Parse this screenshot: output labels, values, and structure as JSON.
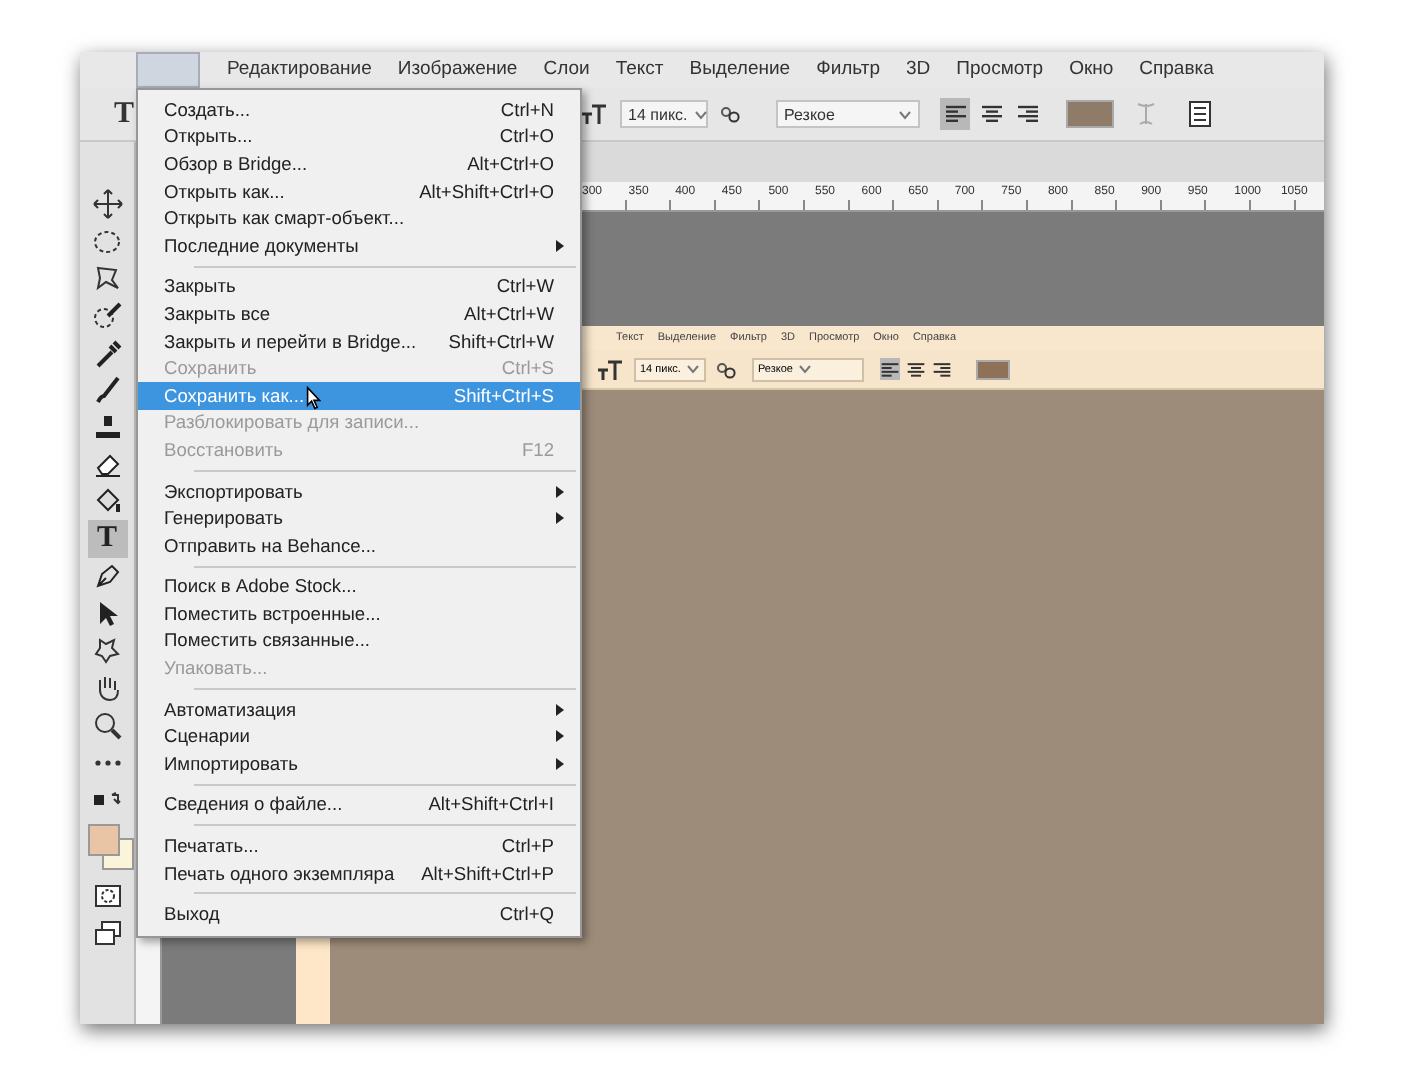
{
  "menubar": {
    "items": [
      {
        "selected": true
      },
      {
        "label": "Редактирование",
        "selected": false
      },
      {
        "label": "Изображение",
        "selected": false
      },
      {
        "label": "Слои",
        "selected": false
      },
      {
        "label": "Текст",
        "selected": false
      },
      {
        "label": "Выделение",
        "selected": false
      },
      {
        "label": "Фильтр",
        "selected": false
      },
      {
        "label": "3D",
        "selected": false
      },
      {
        "label": "Просмотр",
        "selected": false
      },
      {
        "label": "Окно",
        "selected": false
      },
      {
        "label": "Справка",
        "selected": false
      }
    ]
  },
  "options_bar": {
    "tool_glyph": "T",
    "font_size": "14 пикс.",
    "antialias": "Резкое",
    "align": [
      {
        "selected": true
      },
      {
        "selected": false
      },
      {
        "selected": false
      }
    ]
  },
  "tools": [
    {
      "kind": "move",
      "selected": false
    },
    {
      "kind": "marquee",
      "selected": false
    },
    {
      "kind": "lasso",
      "selected": false
    },
    {
      "kind": "quick-select",
      "selected": false
    },
    {
      "kind": "eyedropper",
      "selected": false
    },
    {
      "kind": "brush",
      "selected": false
    },
    {
      "kind": "stamp",
      "selected": false
    },
    {
      "kind": "eraser",
      "selected": false
    },
    {
      "kind": "bucket",
      "selected": false
    },
    {
      "kind": "glyph",
      "glyph": "T",
      "selected": true
    },
    {
      "kind": "pen",
      "selected": false
    },
    {
      "kind": "arrow",
      "selected": false
    },
    {
      "kind": "shape",
      "selected": false
    },
    {
      "kind": "hand",
      "selected": false
    },
    {
      "kind": "zoom",
      "selected": false
    },
    {
      "kind": "more",
      "selected": false
    },
    {
      "kind": "swap",
      "selected": false
    },
    {
      "kind": "colors",
      "selected": false
    },
    {
      "kind": "quickmask",
      "selected": false
    },
    {
      "kind": "screen",
      "selected": false
    }
  ],
  "ruler": [
    "300",
    "350",
    "400",
    "450",
    "500",
    "550",
    "600",
    "650",
    "700",
    "750",
    "800",
    "850",
    "900",
    "950",
    "1000",
    "1050"
  ],
  "file_menu": [
    [
      {
        "label": "Создать...",
        "shortcut": "Ctrl+N",
        "submenu": false,
        "disabled": false,
        "selected": false
      },
      {
        "label": "Открыть...",
        "shortcut": "Ctrl+O",
        "submenu": false,
        "disabled": false,
        "selected": false
      },
      {
        "label": "Обзор в Bridge...",
        "shortcut": "Alt+Ctrl+O",
        "submenu": false,
        "disabled": false,
        "selected": false
      },
      {
        "label": "Открыть как...",
        "shortcut": "Alt+Shift+Ctrl+O",
        "submenu": false,
        "disabled": false,
        "selected": false
      },
      {
        "label": "Открыть как смарт-объект...",
        "submenu": false,
        "disabled": false,
        "selected": false
      },
      {
        "label": "Последние документы",
        "submenu": true,
        "disabled": false,
        "selected": false
      }
    ],
    [
      {
        "label": "Закрыть",
        "shortcut": "Ctrl+W",
        "submenu": false,
        "disabled": false,
        "selected": false
      },
      {
        "label": "Закрыть все",
        "shortcut": "Alt+Ctrl+W",
        "submenu": false,
        "disabled": false,
        "selected": false
      },
      {
        "label": "Закрыть и перейти в Bridge...",
        "shortcut": "Shift+Ctrl+W",
        "submenu": false,
        "disabled": false,
        "selected": false
      },
      {
        "label": "Сохранить",
        "shortcut": "Ctrl+S",
        "submenu": false,
        "disabled": true,
        "selected": false
      },
      {
        "label": "Сохранить как...",
        "shortcut": "Shift+Ctrl+S",
        "submenu": false,
        "disabled": false,
        "selected": true
      },
      {
        "label": "Разблокировать для записи...",
        "submenu": false,
        "disabled": true,
        "selected": false
      },
      {
        "label": "Восстановить",
        "shortcut": "F12",
        "submenu": false,
        "disabled": true,
        "selected": false
      }
    ],
    [
      {
        "label": "Экспортировать",
        "submenu": true,
        "disabled": false,
        "selected": false
      },
      {
        "label": "Генерировать",
        "submenu": true,
        "disabled": false,
        "selected": false
      },
      {
        "label": "Отправить на Behance...",
        "submenu": false,
        "disabled": false,
        "selected": false
      }
    ],
    [
      {
        "label": "Поиск в Adobe Stock...",
        "submenu": false,
        "disabled": false,
        "selected": false
      },
      {
        "label": "Поместить встроенные...",
        "submenu": false,
        "disabled": false,
        "selected": false
      },
      {
        "label": "Поместить связанные...",
        "submenu": false,
        "disabled": false,
        "selected": false
      },
      {
        "label": "Упаковать...",
        "submenu": false,
        "disabled": true,
        "selected": false
      }
    ],
    [
      {
        "label": "Автоматизация",
        "submenu": true,
        "disabled": false,
        "selected": false
      },
      {
        "label": "Сценарии",
        "submenu": true,
        "disabled": false,
        "selected": false
      },
      {
        "label": "Импортировать",
        "submenu": true,
        "disabled": false,
        "selected": false
      }
    ],
    [
      {
        "label": "Сведения о файле...",
        "shortcut": "Alt+Shift+Ctrl+I",
        "submenu": false,
        "disabled": false,
        "selected": false
      }
    ],
    [
      {
        "label": "Печатать...",
        "shortcut": "Ctrl+P",
        "submenu": false,
        "disabled": false,
        "selected": false
      },
      {
        "label": "Печать одного экземпляра",
        "shortcut": "Alt+Shift+Ctrl+P",
        "submenu": false,
        "disabled": false,
        "selected": false
      }
    ],
    [
      {
        "label": "Выход",
        "shortcut": "Ctrl+Q",
        "submenu": false,
        "disabled": false,
        "selected": false
      }
    ]
  ],
  "inner_screenshot": {
    "menu_items": [
      "Текст",
      "Выделение",
      "Фильтр",
      "3D",
      "Просмотр",
      "Окно",
      "Справка"
    ],
    "font_size": "14 пикс.",
    "antialias": "Резкое",
    "align": [
      {
        "selected": true
      },
      {
        "selected": false
      },
      {
        "selected": false
      }
    ]
  }
}
